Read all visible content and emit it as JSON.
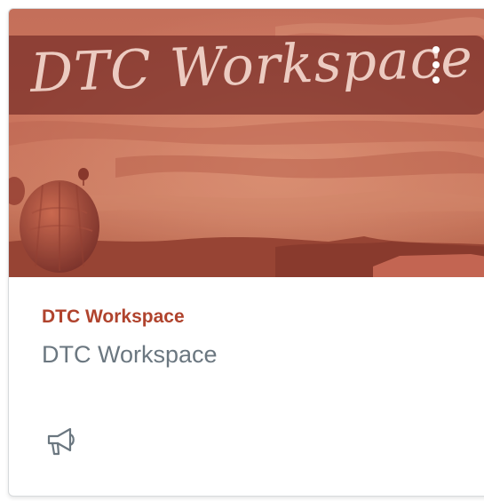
{
  "card": {
    "banner_text": "DTC Workspace",
    "course_name": "DTC Workspace",
    "course_code": "DTC Workspace",
    "options_icon": "vertical-ellipsis-icon",
    "announcements_icon": "megaphone-icon"
  },
  "colors": {
    "course_title": "#b0432d",
    "course_code": "#6b7780",
    "hero_tint": "#c86a4f",
    "banner": "#762c26"
  }
}
